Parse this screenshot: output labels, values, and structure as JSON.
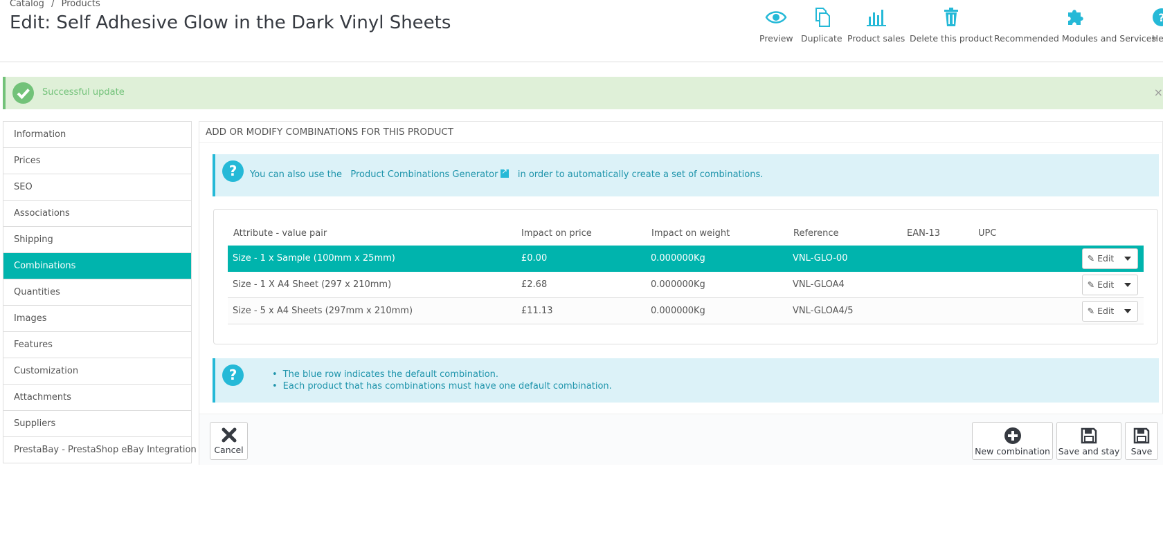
{
  "breadcrumb": {
    "items": [
      "Catalog",
      "/",
      "Products"
    ]
  },
  "page_title": "Edit: Self Adhesive Glow in the Dark Vinyl Sheets",
  "toolbar": {
    "preview": "Preview",
    "duplicate": "Duplicate",
    "product_sales": "Product sales",
    "delete": "Delete this product",
    "recommended": "Recommended Modules and Services",
    "help": "Help"
  },
  "alert": {
    "text": "Successful update",
    "close": "×"
  },
  "sidebar": {
    "items": [
      {
        "label": "Information"
      },
      {
        "label": "Prices"
      },
      {
        "label": "SEO"
      },
      {
        "label": "Associations"
      },
      {
        "label": "Shipping"
      },
      {
        "label": "Combinations",
        "active": true
      },
      {
        "label": "Quantities"
      },
      {
        "label": "Images"
      },
      {
        "label": "Features"
      },
      {
        "label": "Customization"
      },
      {
        "label": "Attachments"
      },
      {
        "label": "Suppliers"
      },
      {
        "label": "PrestaBay - PrestaShop eBay Integration"
      }
    ]
  },
  "panel": {
    "heading": "ADD OR MODIFY COMBINATIONS FOR THIS PRODUCT",
    "info1": {
      "before": "You can also use the",
      "link": "Product Combinations Generator",
      "after": "in order to automatically create a set of combinations."
    },
    "table": {
      "headers": [
        "Attribute - value pair",
        "Impact on price",
        "Impact on weight",
        "Reference",
        "EAN-13",
        "UPC"
      ],
      "rows": [
        {
          "attribute": "Size - 1 x Sample (100mm x 25mm)",
          "price": "£0.00",
          "weight": "0.000000Kg",
          "reference": "VNL-GLO-00",
          "ean": "",
          "upc": "",
          "default": true
        },
        {
          "attribute": "Size - 1 X A4 Sheet (297 x 210mm)",
          "price": "£2.68",
          "weight": "0.000000Kg",
          "reference": "VNL-GLOA4",
          "ean": "",
          "upc": ""
        },
        {
          "attribute": "Size - 5 x A4 Sheets (297mm x 210mm)",
          "price": "£11.13",
          "weight": "0.000000Kg",
          "reference": "VNL-GLOA4/5",
          "ean": "",
          "upc": ""
        }
      ],
      "edit_label": "Edit"
    },
    "info2": {
      "bullets": [
        "The blue row indicates the default combination.",
        "Each product that has combinations must have one default combination."
      ]
    }
  },
  "footer": {
    "cancel": "Cancel",
    "new_combination": "New combination",
    "save_and_stay": "Save and stay",
    "save": "Save"
  },
  "colors": {
    "accent": "#00b4ad",
    "info": "#25b9d7",
    "success": "#72c279"
  }
}
